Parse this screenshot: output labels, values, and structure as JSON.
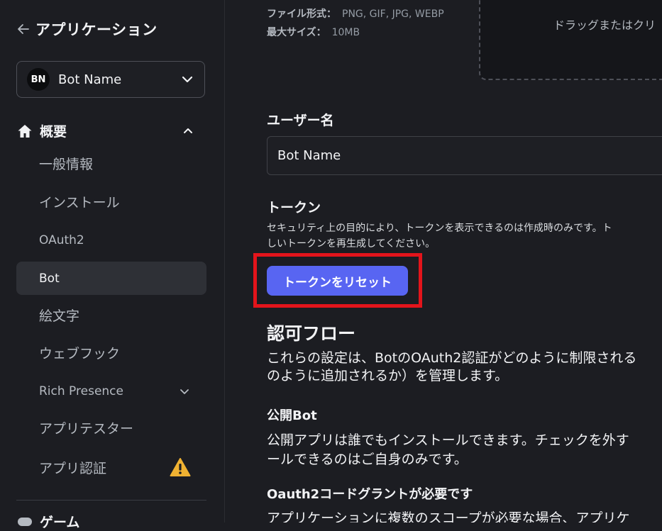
{
  "sidebar": {
    "back_label": "アプリケーション",
    "app_selector": {
      "avatar": "BN",
      "name": "Bot Name"
    },
    "section_title": "概要",
    "items": [
      {
        "label": "一般情報"
      },
      {
        "label": "インストール"
      },
      {
        "label": "OAuth2"
      },
      {
        "label": "Bot",
        "active": true
      },
      {
        "label": "絵文字"
      },
      {
        "label": "ウェブフック"
      },
      {
        "label": "Rich Presence"
      },
      {
        "label": "アプリテスター"
      },
      {
        "label": "アプリ認証"
      }
    ],
    "games_label": "ゲーム"
  },
  "main": {
    "file_format_label": "ファイル形式：",
    "file_format_value": "PNG, GIF, JPG, WEBP",
    "max_size_label": "最大サイズ：",
    "max_size_value": "10MB",
    "dropzone_text": "ドラッグまたはクリ",
    "username_label": "ユーザー名",
    "username_value": "Bot Name",
    "token_label": "トークン",
    "token_desc_line1": "セキュリティ上の目的により、トークンを表示できるのは作成時のみです。ト",
    "token_desc_line2": "しいトークンを再生成してください。",
    "reset_button": "トークンをリセット",
    "auth_flow_title": "認可フロー",
    "auth_flow_line1": "これらの設定は、BotのOAuth2認証がどのように制限される",
    "auth_flow_line2": "のように追加されるか）を管理します。",
    "public_bot_title": "公開Bot",
    "public_bot_line1": "公開アプリは誰でもインストールできます。チェックを外す",
    "public_bot_line2": "ールできるのはご自身のみです。",
    "oauth_grant_title": "Oauth2コードグラントが必要です",
    "oauth_grant_line1": "アプリケーションに複数のスコープが必要な場合、アプリケ"
  },
  "colors": {
    "accent": "#5865f2",
    "highlight": "#e3141b",
    "warning": "#f0b232"
  }
}
